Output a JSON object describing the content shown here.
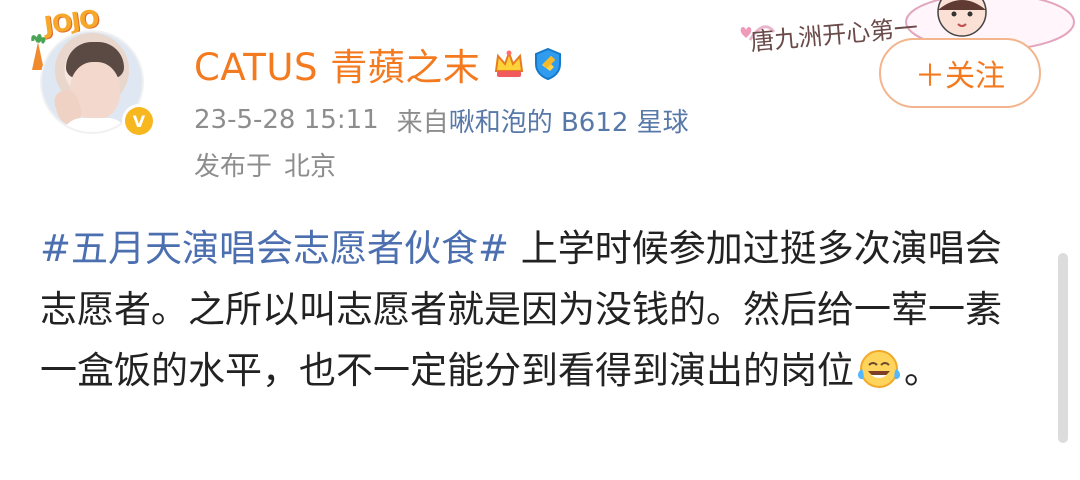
{
  "post": {
    "username": "CATUS 青蘋之末",
    "avatar_badge_text": "JOJO",
    "vip_badge": "V",
    "meta": {
      "time": "23-5-28 15:11",
      "source_prefix": "来自",
      "source": "啾和泡的 B612 星球"
    },
    "location": {
      "prefix": "发布于",
      "city": "北京"
    },
    "decoration_card_text": "唐九洲开心第一",
    "follow_label": "＋关注",
    "content": {
      "hashtag": "#五月天演唱会志愿者伙食#",
      "text": " 上学时候参加过挺多次演唱会志愿者。之所以叫志愿者就是因为没钱的。然后给一荤一素一盒饭的水平，也不一定能分到看得到演出的岗位",
      "emoji": "laugh-cry-emoji",
      "ending": "。"
    }
  },
  "colors": {
    "username": "#f37a1f",
    "meta": "#8d8d8d",
    "link": "#5879a8",
    "hashtag": "#4c6fb0",
    "text": "#222222"
  }
}
